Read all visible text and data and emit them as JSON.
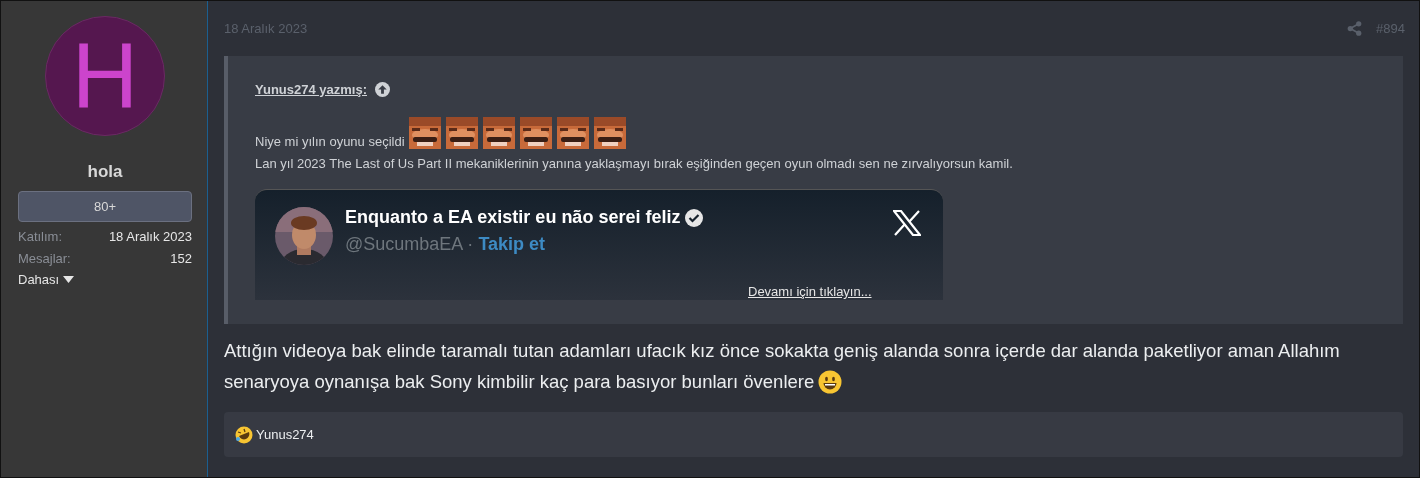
{
  "post": {
    "date": "18 Aralık 2023",
    "number": "#894"
  },
  "user": {
    "avatar_letter": "H",
    "name": "hola",
    "badge": "80+",
    "stats": [
      {
        "label": "Katılım:",
        "value": "18 Aralık 2023"
      },
      {
        "label": "Mesajlar:",
        "value": "152"
      }
    ],
    "more": "Dahası"
  },
  "quote": {
    "author": "Yunus274 yazmış:",
    "lines": [
      "Niye mi yılın oyunu seçildi",
      "Lan yıl 2023 The Last of Us Part II mekaniklerinin yanına yaklaşmayı bırak eşiğinden geçen oyun olmadı sen ne zırvalıyorsun kamil."
    ],
    "embed": {
      "name": "Enquanto a EA existir eu não serei feliz",
      "handle": "@SucumbaEA",
      "separator": "·",
      "follow": "Takip et"
    },
    "expand": "Devamı için tıklayın..."
  },
  "message_lines": [
    "Attığın videoya bak elinde taramalı tutan adamları ufacık kız önce sokakta geniş alanda sonra içerde dar alanda paketliyor aman Allahım",
    "senaryoya oynanışa bak Sony kimbilir kaç para basıyor bunları övenlere"
  ],
  "reactions": [
    {
      "user": "Yunus274"
    }
  ]
}
